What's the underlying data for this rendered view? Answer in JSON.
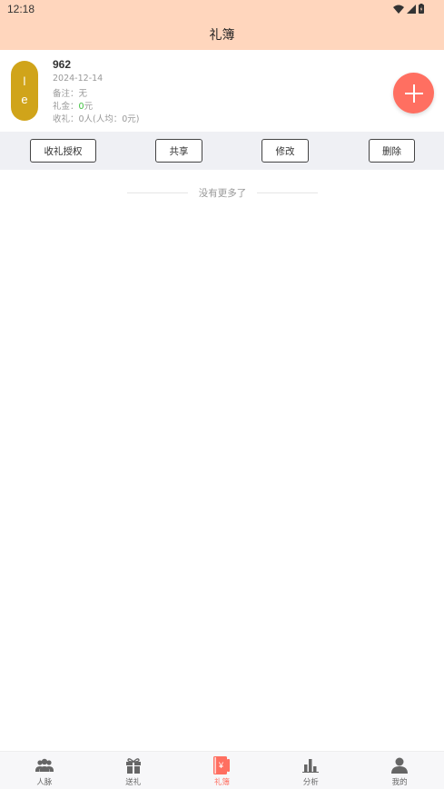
{
  "status": {
    "time": "12:18"
  },
  "header": {
    "title": "礼簿"
  },
  "book": {
    "avatar_chars": [
      "l",
      "e"
    ],
    "name": "962",
    "date": "2024-12-14",
    "note_label": "备注：",
    "note_value": "无",
    "gift_label": "礼金：",
    "gift_amount": "0",
    "gift_unit": "元",
    "received": "收礼：0人(人均：0元)"
  },
  "actions": {
    "authorize": "收礼授权",
    "share": "共享",
    "edit": "修改",
    "delete": "删除"
  },
  "list": {
    "no_more": "没有更多了"
  },
  "nav": {
    "items": [
      {
        "label": "人脉"
      },
      {
        "label": "送礼"
      },
      {
        "label": "礼簿"
      },
      {
        "label": "分析"
      },
      {
        "label": "我的"
      }
    ]
  },
  "colors": {
    "accent": "#ff6f61",
    "header_bg": "#ffd6bd",
    "avatar_bg": "#d0a41a"
  }
}
